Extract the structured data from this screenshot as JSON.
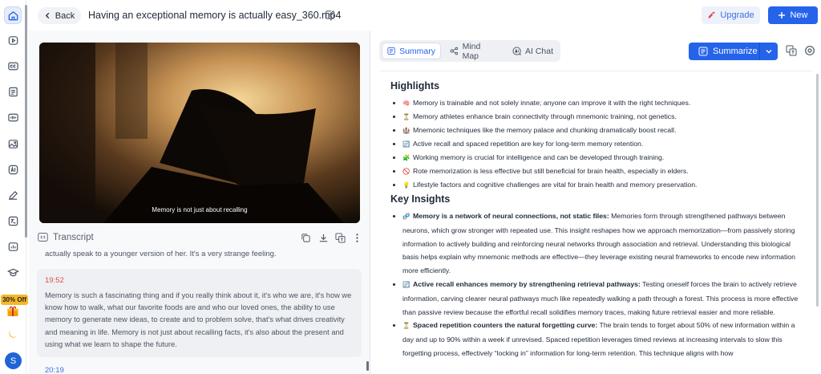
{
  "header": {
    "back_label": "Back",
    "file_title": "Having an exceptional memory is actually easy_360.mp4",
    "upgrade_label": "Upgrade",
    "new_label": "New"
  },
  "sidebar": {
    "icons": [
      "home-icon",
      "video-icon",
      "captions-icon",
      "document-icon",
      "audio-icon",
      "image-icon",
      "ai-icon",
      "edit-pen-icon",
      "translate-icon",
      "chart-icon",
      "graduation-icon"
    ],
    "promo_label": "30% Off",
    "avatar_initial": "S"
  },
  "video": {
    "subtitle": "Memory is not just about recalling"
  },
  "transcript": {
    "title": "Transcript",
    "previous_line": "actually speak to a younger version of her. It's a very strange feeling.",
    "segments": [
      {
        "time": "19:52",
        "text": "Memory is such a fascinating thing and if you really think about it, it's who we are, it's how we know how to walk, what our favorite foods are and who our loved ones, the ability to use memory to generate new ideas, to create and to problem solve, that's what drives creativity and meaning in life. Memory is not just about recalling facts, it's also about the present and using what we learn to shape the future."
      }
    ],
    "next_time": "20:19"
  },
  "tabs": [
    {
      "label": "Summary",
      "icon": "summary-icon",
      "active": true
    },
    {
      "label": "Mind Map",
      "icon": "mind-map-icon",
      "active": false
    },
    {
      "label": "AI Chat",
      "icon": "ai-chat-icon",
      "active": false
    }
  ],
  "summarize_label": "Summarize",
  "highlights": {
    "title": "Highlights",
    "items": [
      {
        "emoji": "🧠",
        "text": "Memory is trainable and not solely innate; anyone can improve it with the right techniques."
      },
      {
        "emoji": "⏳",
        "text": "Memory athletes enhance brain connectivity through mnemonic training, not genetics."
      },
      {
        "emoji": "🏰",
        "text": "Mnemonic techniques like the memory palace and chunking dramatically boost recall."
      },
      {
        "emoji": "🔄",
        "text": "Active recall and spaced repetition are key for long-term memory retention."
      },
      {
        "emoji": "🧩",
        "text": "Working memory is crucial for intelligence and can be developed through training."
      },
      {
        "emoji": "🚫",
        "text": "Rote memorization is less effective but still beneficial for brain health, especially in elders."
      },
      {
        "emoji": "💡",
        "text": "Lifestyle factors and cognitive challenges are vital for brain health and memory preservation."
      }
    ]
  },
  "insights": {
    "title": "Key Insights",
    "items": [
      {
        "emoji": "🧬",
        "bold": "Memory is a network of neural connections, not static files:",
        "text": " Memories form through strengthened pathways between neurons, which grow stronger with repeated use. This insight reshapes how we approach memorization—from passively storing information to actively building and reinforcing neural networks through association and retrieval. Understanding this biological basis helps explain why mnemonic methods are effective—they leverage existing neural frameworks to encode new information more efficiently."
      },
      {
        "emoji": "🔄",
        "bold": "Active recall enhances memory by strengthening retrieval pathways:",
        "text": " Testing oneself forces the brain to actively retrieve information, carving clearer neural pathways much like repeatedly walking a path through a forest. This process is more effective than passive review because the effortful recall solidifies memory traces, making future retrieval easier and more reliable."
      },
      {
        "emoji": "⏳",
        "bold": "Spaced repetition counters the natural forgetting curve:",
        "text": " The brain tends to forget about 50% of new information within a day and up to 90% within a week if unrevised. Spaced repetition leverages timed reviews at increasing intervals to slow this forgetting process, effectively “locking in” information for long-term retention. This technique aligns with how"
      }
    ]
  },
  "colors": {
    "accent": "#2563eb",
    "timestamp_active": "#e25050",
    "promo": "#f6b82b"
  }
}
